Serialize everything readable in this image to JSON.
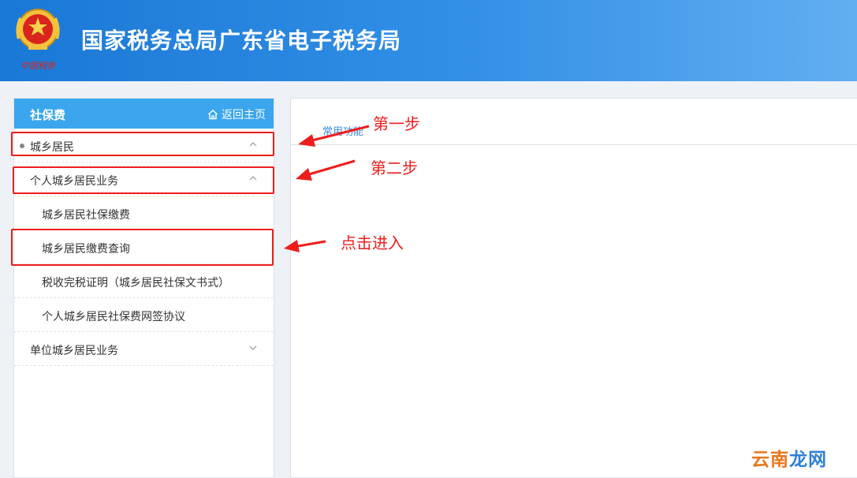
{
  "header": {
    "title": "国家税务总局广东省电子税务局",
    "emblem_caption": "中国税务"
  },
  "sidebar": {
    "title": "社保费",
    "home_link": "返回主页",
    "items": [
      {
        "label": "城乡居民",
        "level": 1,
        "expanded": true
      },
      {
        "label": "个人城乡居民业务",
        "level": 2,
        "expanded": true
      },
      {
        "label": "城乡居民社保缴费",
        "level": 3
      },
      {
        "label": "城乡居民缴费查询",
        "level": 3
      },
      {
        "label": "税收完税证明（城乡居民社保文书式）",
        "level": 3
      },
      {
        "label": "个人城乡居民社保费网签协议",
        "level": 3
      },
      {
        "label": "单位城乡居民业务",
        "level": 2,
        "expanded": false
      }
    ]
  },
  "main": {
    "tab_label": "常用功能"
  },
  "annotations": {
    "step1": "第一步",
    "step2": "第二步",
    "step3": "点击进入"
  },
  "watermark": {
    "part1": "云南",
    "part2": "龙网"
  },
  "colors": {
    "header_blue": "#1a78d6",
    "sidebar_head": "#3ba6ee",
    "annotation_red": "#ee1d1d",
    "link_blue": "#3b8be0"
  }
}
